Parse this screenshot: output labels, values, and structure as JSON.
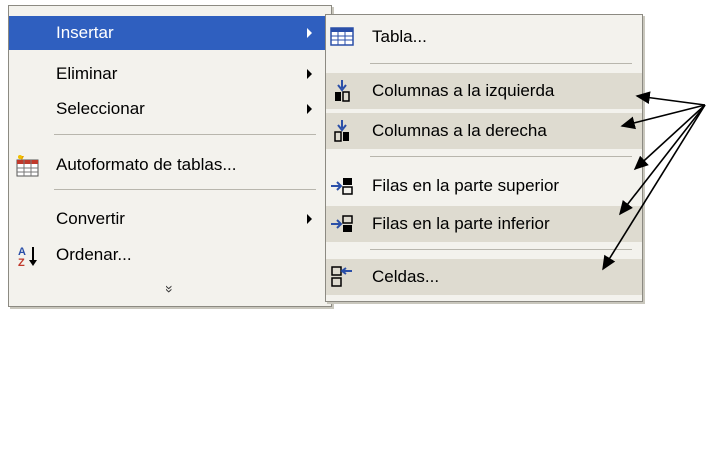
{
  "main_menu": {
    "items": [
      {
        "label": "Insertar"
      },
      {
        "label": "Eliminar"
      },
      {
        "label": "Seleccionar"
      },
      {
        "label": "Autoformato de tablas..."
      },
      {
        "label": "Convertir"
      },
      {
        "label": "Ordenar..."
      }
    ],
    "more_glyph": "»"
  },
  "submenu": {
    "items": [
      {
        "label": "Tabla..."
      },
      {
        "label": "Columnas a la izquierda"
      },
      {
        "label": "Columnas a la derecha"
      },
      {
        "label": "Filas en la parte superior"
      },
      {
        "label": "Filas en la parte inferior"
      },
      {
        "label": "Celdas..."
      }
    ]
  },
  "colors": {
    "highlight": "#2f5fbf",
    "menu_bg": "#f3f2ed",
    "submenu_hover": "#dedbd0"
  }
}
